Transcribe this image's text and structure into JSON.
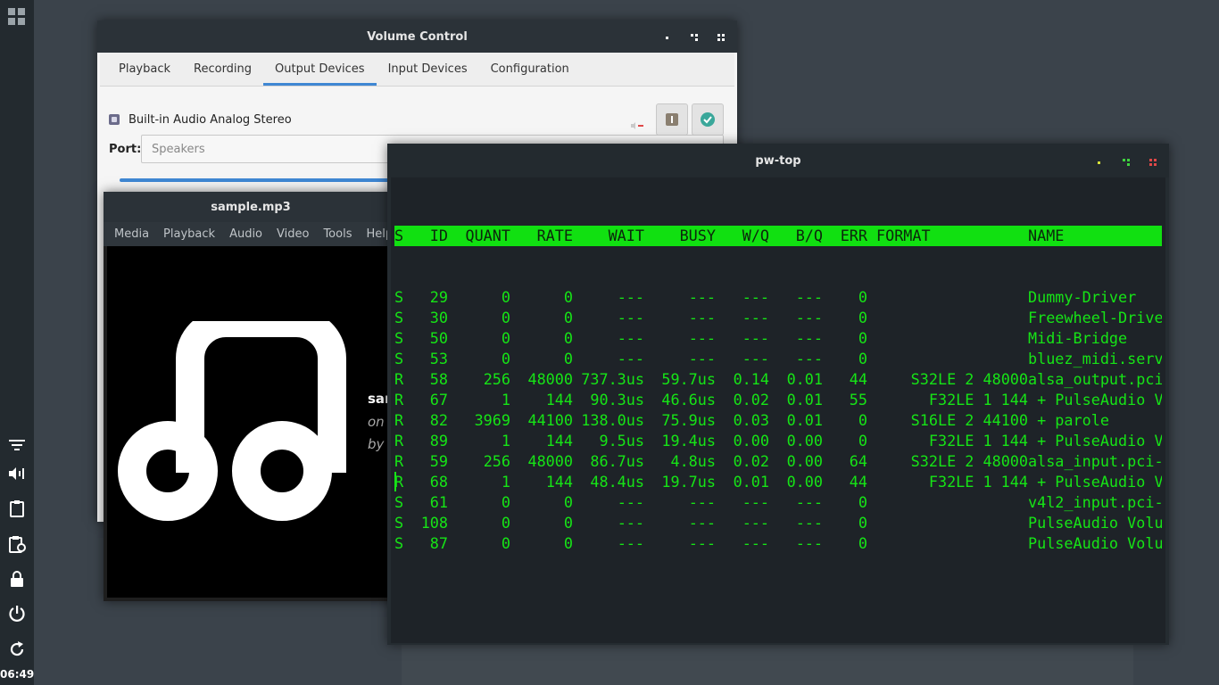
{
  "panel": {
    "clock": "06:49"
  },
  "volume_control": {
    "title": "Volume Control",
    "tabs": [
      {
        "label": "Playback"
      },
      {
        "label": "Recording"
      },
      {
        "label": "Output Devices",
        "active": true
      },
      {
        "label": "Input Devices"
      },
      {
        "label": "Configuration"
      }
    ],
    "device_name": "Built-in Audio Analog Stereo",
    "port_label": "Port:",
    "port_value": "Speakers",
    "accent_color": "#3f87d3"
  },
  "vlc": {
    "title": "sample.mp3",
    "menu": [
      "Media",
      "Playback",
      "Audio",
      "Video",
      "Tools",
      "Help"
    ],
    "meta_title": "sar",
    "meta_on": "on",
    "meta_by": "by"
  },
  "terminal": {
    "title": "pw-top",
    "text_color": "#16e416",
    "columns": [
      "S",
      "ID",
      "QUANT",
      "RATE",
      "WAIT",
      "BUSY",
      "W/Q",
      "B/Q",
      "ERR",
      "FORMAT",
      "NAME"
    ],
    "rows": [
      [
        "S",
        "29",
        "0",
        "0",
        "---",
        "---",
        "---",
        "---",
        "0",
        "",
        "Dummy-Driver"
      ],
      [
        "S",
        "30",
        "0",
        "0",
        "---",
        "---",
        "---",
        "---",
        "0",
        "",
        "Freewheel-Drive"
      ],
      [
        "S",
        "50",
        "0",
        "0",
        "---",
        "---",
        "---",
        "---",
        "0",
        "",
        "Midi-Bridge"
      ],
      [
        "S",
        "53",
        "0",
        "0",
        "---",
        "---",
        "---",
        "---",
        "0",
        "",
        "bluez_midi.serv"
      ],
      [
        "R",
        "58",
        "256",
        "48000",
        "737.3us",
        "59.7us",
        "0.14",
        "0.01",
        "44",
        "S32LE 2 48000",
        "alsa_output.pci"
      ],
      [
        "R",
        "67",
        "1",
        "144",
        "90.3us",
        "46.6us",
        "0.02",
        "0.01",
        "55",
        "F32LE 1 144",
        " + PulseAudio V"
      ],
      [
        "R",
        "82",
        "3969",
        "44100",
        "138.0us",
        "75.9us",
        "0.03",
        "0.01",
        "0",
        "S16LE 2 44100",
        " + parole"
      ],
      [
        "R",
        "89",
        "1",
        "144",
        "9.5us",
        "19.4us",
        "0.00",
        "0.00",
        "0",
        "F32LE 1 144",
        " + PulseAudio V"
      ],
      [
        "R",
        "59",
        "256",
        "48000",
        "86.7us",
        "4.8us",
        "0.02",
        "0.00",
        "64",
        "S32LE 2 48000",
        "alsa_input.pci-"
      ],
      [
        "R",
        "68",
        "1",
        "144",
        "48.4us",
        "19.7us",
        "0.01",
        "0.00",
        "44",
        "F32LE 1 144",
        " + PulseAudio V"
      ],
      [
        "S",
        "61",
        "0",
        "0",
        "---",
        "---",
        "---",
        "---",
        "0",
        "",
        "v4l2_input.pci-"
      ],
      [
        "S",
        "108",
        "0",
        "0",
        "---",
        "---",
        "---",
        "---",
        "0",
        "",
        "PulseAudio Volu"
      ],
      [
        "S",
        "87",
        "0",
        "0",
        "---",
        "---",
        "---",
        "---",
        "0",
        "",
        "PulseAudio Volu"
      ]
    ]
  }
}
